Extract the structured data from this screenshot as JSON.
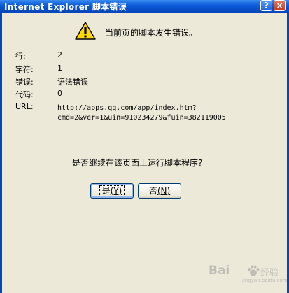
{
  "window": {
    "title": "Internet Explorer 脚本错误",
    "help_label": "?",
    "close_label": "×"
  },
  "dialog": {
    "message": "当前页的脚本发生错误。",
    "details": [
      {
        "label": "行:",
        "value": "2"
      },
      {
        "label": "字符:",
        "value": "1"
      },
      {
        "label": "错误:",
        "value": "语法错误"
      },
      {
        "label": "代码:",
        "value": "0"
      }
    ],
    "url_label": "URL:",
    "url_lines": [
      "http://apps.qq.com/app/index.htm?",
      "cmd=2&ver=1&uin=910234279&fuin=382119005"
    ],
    "question": "是否继续在该页面上运行脚本程序?",
    "yes_button": {
      "text": "是",
      "mnemonic": "(Y)"
    },
    "no_button": {
      "text": "否",
      "mnemonic": "(N)"
    }
  },
  "watermark": {
    "brand_left": "Bai",
    "brand_right": "经验",
    "url": "jingyan.baidu.com"
  }
}
